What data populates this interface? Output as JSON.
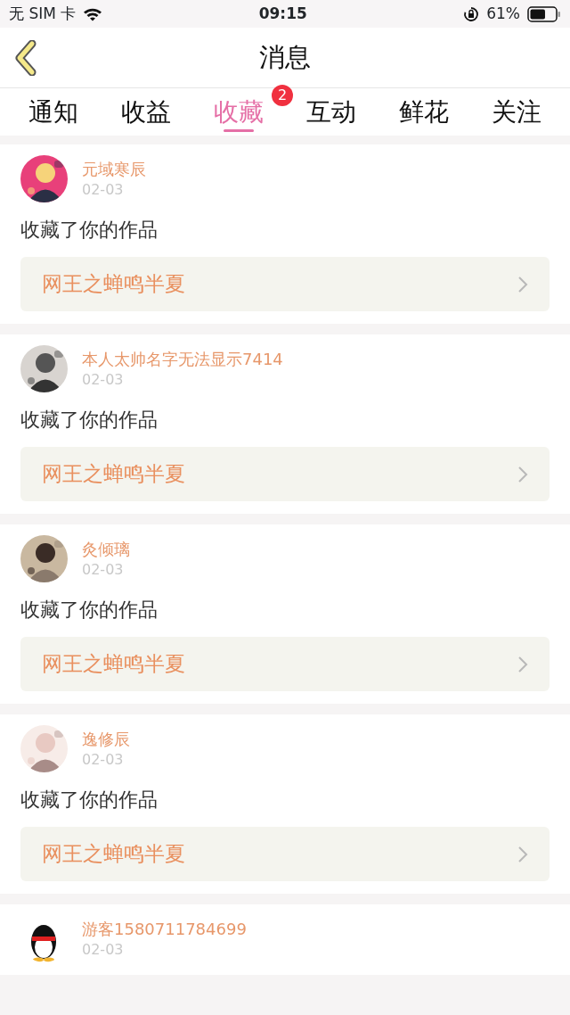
{
  "status_bar": {
    "carrier": "无 SIM 卡",
    "time": "09:15",
    "battery": "61%"
  },
  "header": {
    "title": "消息"
  },
  "tabs": [
    {
      "label": "通知",
      "selected": false
    },
    {
      "label": "收益",
      "selected": false
    },
    {
      "label": "收藏",
      "selected": true,
      "badge": "2"
    },
    {
      "label": "互动",
      "selected": false
    },
    {
      "label": "鲜花",
      "selected": false
    },
    {
      "label": "关注",
      "selected": false
    }
  ],
  "messages": [
    {
      "user": "元域寒辰",
      "date": "02-03",
      "action": "收藏了你的作品",
      "work": "网王之蝉鸣半夏"
    },
    {
      "user": "本人太帅名字无法显示7414",
      "date": "02-03",
      "action": "收藏了你的作品",
      "work": "网王之蝉鸣半夏"
    },
    {
      "user": "灸倾璃",
      "date": "02-03",
      "action": "收藏了你的作品",
      "work": "网王之蝉鸣半夏"
    },
    {
      "user": "逸修辰",
      "date": "02-03",
      "action": "收藏了你的作品",
      "work": "网王之蝉鸣半夏"
    },
    {
      "user": "游客1580711784699",
      "date": "02-03"
    }
  ]
}
